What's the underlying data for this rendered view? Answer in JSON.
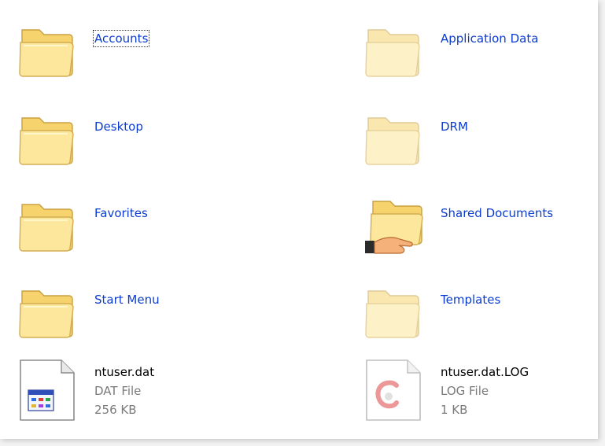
{
  "explorer": {
    "items": [
      {
        "name": "Accounts",
        "kind": "folder",
        "selected": true,
        "icon": "folder-icon"
      },
      {
        "name": "Application Data",
        "kind": "folder",
        "hidden": true,
        "icon": "folder-icon"
      },
      {
        "name": "Desktop",
        "kind": "folder",
        "icon": "folder-icon"
      },
      {
        "name": "DRM",
        "kind": "folder",
        "hidden": true,
        "icon": "folder-icon"
      },
      {
        "name": "Favorites",
        "kind": "folder",
        "icon": "folder-icon"
      },
      {
        "name": "Shared Documents",
        "kind": "folder",
        "shared": true,
        "icon": "shared-folder-icon"
      },
      {
        "name": "Start Menu",
        "kind": "folder",
        "icon": "folder-icon"
      },
      {
        "name": "Templates",
        "kind": "folder",
        "hidden": true,
        "icon": "folder-icon"
      },
      {
        "name": "ntuser.dat",
        "kind": "file",
        "type": "DAT File",
        "size": "256 KB",
        "icon": "dat-file-icon"
      },
      {
        "name": "ntuser.dat.LOG",
        "kind": "file",
        "type": "LOG File",
        "size": "1 KB",
        "hidden": true,
        "icon": "log-file-icon"
      }
    ]
  }
}
